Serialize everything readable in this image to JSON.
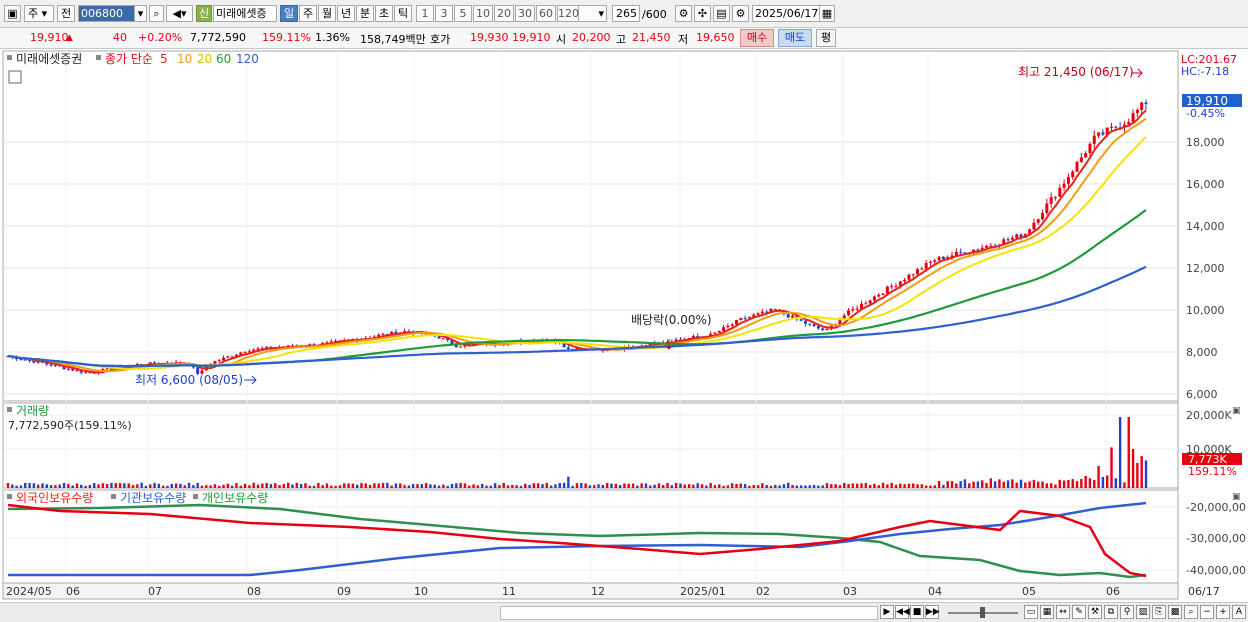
{
  "toolbar": {
    "market": "주",
    "scope": "전",
    "code": "006800",
    "stock_name": "미래에셋증",
    "signal_badge": "신",
    "periods": [
      "일",
      "주",
      "월",
      "년",
      "분",
      "초",
      "틱"
    ],
    "active_period": "일",
    "counts": [
      "1",
      "3",
      "5",
      "10",
      "20",
      "30",
      "60",
      "120"
    ],
    "view_count": "265",
    "max_count": "/600",
    "date": "2025/06/17"
  },
  "quote": {
    "price": "19,910",
    "change": "40",
    "change_pct": "+0.20%",
    "volume": "7,772,590",
    "volume_ratio": "159.11%",
    "turnover": "1.36%",
    "amount": "158,749백만",
    "ask_label": "호가",
    "ask": "19,930",
    "bid": "19,910",
    "open_label": "시",
    "open": "20,200",
    "high_label": "고",
    "high": "21,450",
    "low_label": "저",
    "low": "19,650",
    "buy_btn": "매수",
    "sell_btn": "매도",
    "eval_btn": "평"
  },
  "price_panel": {
    "name_label": "미래에셋증권",
    "ma_title": "종가 단순",
    "ma_periods": [
      {
        "label": "5",
        "color": "#e8231a"
      },
      {
        "label": "10",
        "color": "#f39c12"
      },
      {
        "label": "20",
        "color": "#f5e400"
      },
      {
        "label": "60",
        "color": "#1e9b3a"
      },
      {
        "label": "120",
        "color": "#2f5fd0"
      }
    ],
    "high_note": "최고 21,450 (06/17)",
    "low_note": "최저 6,600 (08/05)",
    "dividend_note": "배당락(0.00%)",
    "lc": "LC:201.67",
    "hc": "HC:-7.18",
    "last_price": "19,910",
    "last_pct": "-0.45%",
    "y_ticks": [
      "18,000",
      "16,000",
      "14,000",
      "12,000",
      "10,000",
      "8,000",
      "6,000"
    ]
  },
  "volume_panel": {
    "title": "거래량",
    "value": "7,772,590주(159.11%)",
    "y_ticks": [
      "20,000K",
      "10,000K"
    ],
    "last": "7,773K",
    "last_pct": "159.11%"
  },
  "holdings_panel": {
    "legend": [
      {
        "label": "외국인보유수량",
        "color": "#e8231a"
      },
      {
        "label": "기관보유수량",
        "color": "#2f5fd0"
      },
      {
        "label": "개인보유수량",
        "color": "#1e9b3a"
      }
    ],
    "y_ticks": [
      "-20,000,00",
      "-30,000,00",
      "-40,000,00"
    ]
  },
  "x_axis": [
    "2024/05",
    "06",
    "07",
    "08",
    "09",
    "10",
    "11",
    "12",
    "2025/01",
    "02",
    "03",
    "04",
    "05",
    "06",
    "06/17"
  ]
}
